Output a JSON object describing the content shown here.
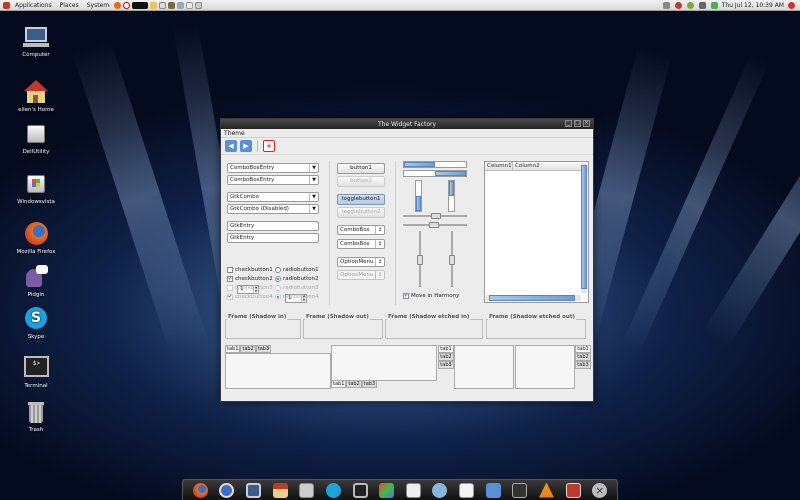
{
  "panel": {
    "menus": [
      "Applications",
      "Places",
      "System"
    ],
    "clock": "Thu Jul 12, 10:39 AM"
  },
  "desktop_icons": [
    {
      "label": "Computer",
      "icon": "computer-icon"
    },
    {
      "label": "ellen's Home",
      "icon": "home-icon"
    },
    {
      "label": "DellUtility",
      "icon": "drive-icon"
    },
    {
      "label": "Windowsvista",
      "icon": "windows-drive-icon"
    },
    {
      "label": "Mozilla Firefox",
      "icon": "firefox-icon"
    },
    {
      "label": "Pidgin",
      "icon": "pidgin-icon"
    },
    {
      "label": "Skype",
      "icon": "skype-icon"
    },
    {
      "label": "Terminal",
      "icon": "terminal-icon"
    },
    {
      "label": "Trash",
      "icon": "trash-icon"
    }
  ],
  "window": {
    "title": "The Widget Factory",
    "menu": "Theme",
    "col1": {
      "combo_entry": "ComboBoxEntry",
      "combo_entry_disabled": "ComboBoxEntry",
      "gtk_combo": "GtkCombo",
      "gtk_combo_disabled": "GtkCombo (Disabled)",
      "entry1": "GtkEntry",
      "entry2": "GtkEntry",
      "spin1": "1",
      "spin2": "1",
      "checks": [
        "checkbutton1",
        "checkbutton2",
        "checkbutton3",
        "checkbutton4"
      ],
      "radios": [
        "radiobutton1",
        "radiobutton2",
        "radiobutton3",
        "radiobutton4"
      ]
    },
    "col2": {
      "button1": "button1",
      "button2": "button2",
      "toggle1": "togglebutton1",
      "toggle2": "togglebutton2",
      "combo1": "ComboBox",
      "combo2": "ComboBox",
      "option1": "OptionMenu",
      "option2": "OptionMenu"
    },
    "harmony": "Move in Harmony",
    "tree": {
      "columns": [
        "Column1",
        "Column2"
      ]
    },
    "frames": [
      "Frame (Shadow in)",
      "Frame (Shadow out)",
      "Frame (Shadow etched in)",
      "Frame (Shadow etched out)"
    ],
    "tabs": [
      "tab1",
      "tab2",
      "tab3"
    ]
  },
  "dock_icons": [
    "firefox-icon",
    "clock-icon",
    "computer-icon",
    "home-icon",
    "archive-icon",
    "skype-icon",
    "terminal-icon",
    "cube-icon",
    "files-icon",
    "settings-icon",
    "notes-icon",
    "calculator-icon",
    "screen-icon",
    "vlc-icon",
    "image-icon",
    "close-icon"
  ]
}
